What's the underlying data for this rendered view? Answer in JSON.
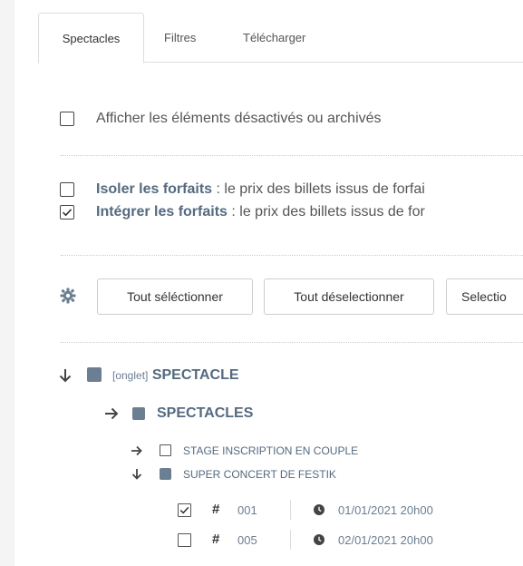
{
  "tabs": [
    {
      "label": "Spectacles",
      "active": true
    },
    {
      "label": "Filtres",
      "active": false
    },
    {
      "label": "Télécharger",
      "active": false
    }
  ],
  "options": {
    "show_disabled_label": "Afficher les éléments désactivés ou archivés",
    "show_disabled_checked": false,
    "isolate_strong": "Isoler les forfaits",
    "isolate_rest": " : le prix des billets issus de forfai",
    "isolate_checked": false,
    "integrate_strong": "Intégrer les forfaits",
    "integrate_rest": " : le prix des billets issus de for",
    "integrate_checked": true
  },
  "toolbar": {
    "select_all_label": "Tout séléctionner",
    "deselect_all_label": "Tout déselectionner",
    "select_partial_label": "Selectio"
  },
  "tree": {
    "root_prefix": "[onglet]",
    "root_label": "SPECTACLE",
    "group_label": "SPECTACLES",
    "item1_label": "STAGE INSCRIPTION EN COUPLE",
    "item2_label": "SUPER CONCERT DE FESTIK",
    "sessions": [
      {
        "checked": true,
        "hash": "#",
        "number": "001",
        "date": "01/01/2021 20h00"
      },
      {
        "checked": false,
        "hash": "#",
        "number": "005",
        "date": "02/01/2021 20h00"
      }
    ]
  },
  "colors": {
    "accent": "#546a80",
    "square": "#6b7e92"
  }
}
